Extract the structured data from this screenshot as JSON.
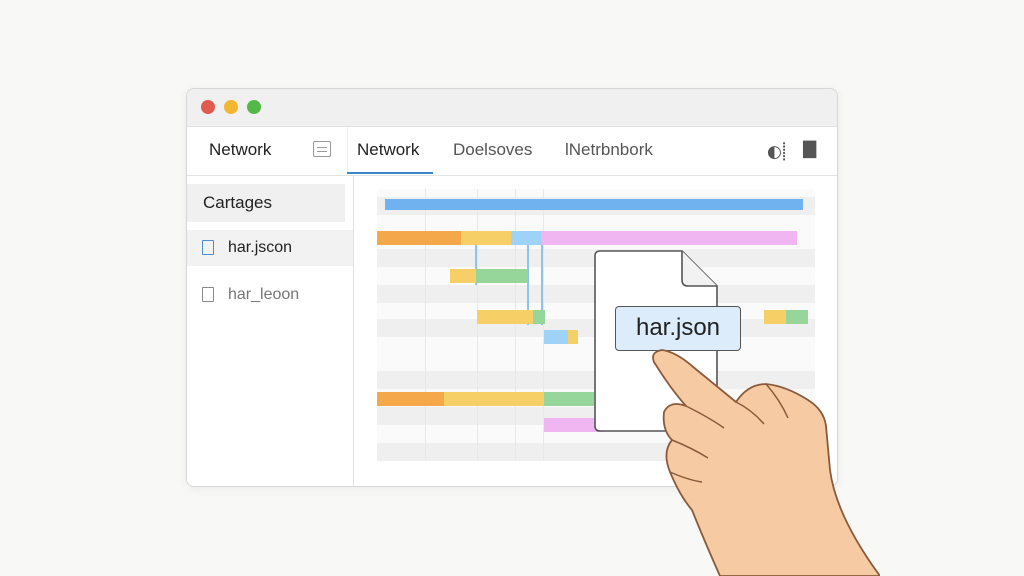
{
  "window": {
    "sidebar_header_tab": "Network",
    "tabs": [
      {
        "label": "Network",
        "active": true
      },
      {
        "label": "Doelsoves",
        "active": false
      },
      {
        "label": "lNetrbnbork",
        "active": false
      }
    ],
    "toolbar_icons": [
      "record-icon",
      "print-icon"
    ]
  },
  "sidebar": {
    "header": "Cartages",
    "items": [
      {
        "label": "har.jscon",
        "selected": true
      },
      {
        "label": "har_leoon",
        "selected": false
      }
    ]
  },
  "drag_file": {
    "label": "har.json"
  },
  "colors": {
    "accent": "#3a87c9",
    "bar_blue": "#6fb2ef",
    "bar_orange": "#f5a84a",
    "bar_yellow": "#f6d067",
    "bar_green": "#96d69a",
    "bar_pink": "#efb6f2",
    "bar_light_blue": "#9ed2f6"
  }
}
